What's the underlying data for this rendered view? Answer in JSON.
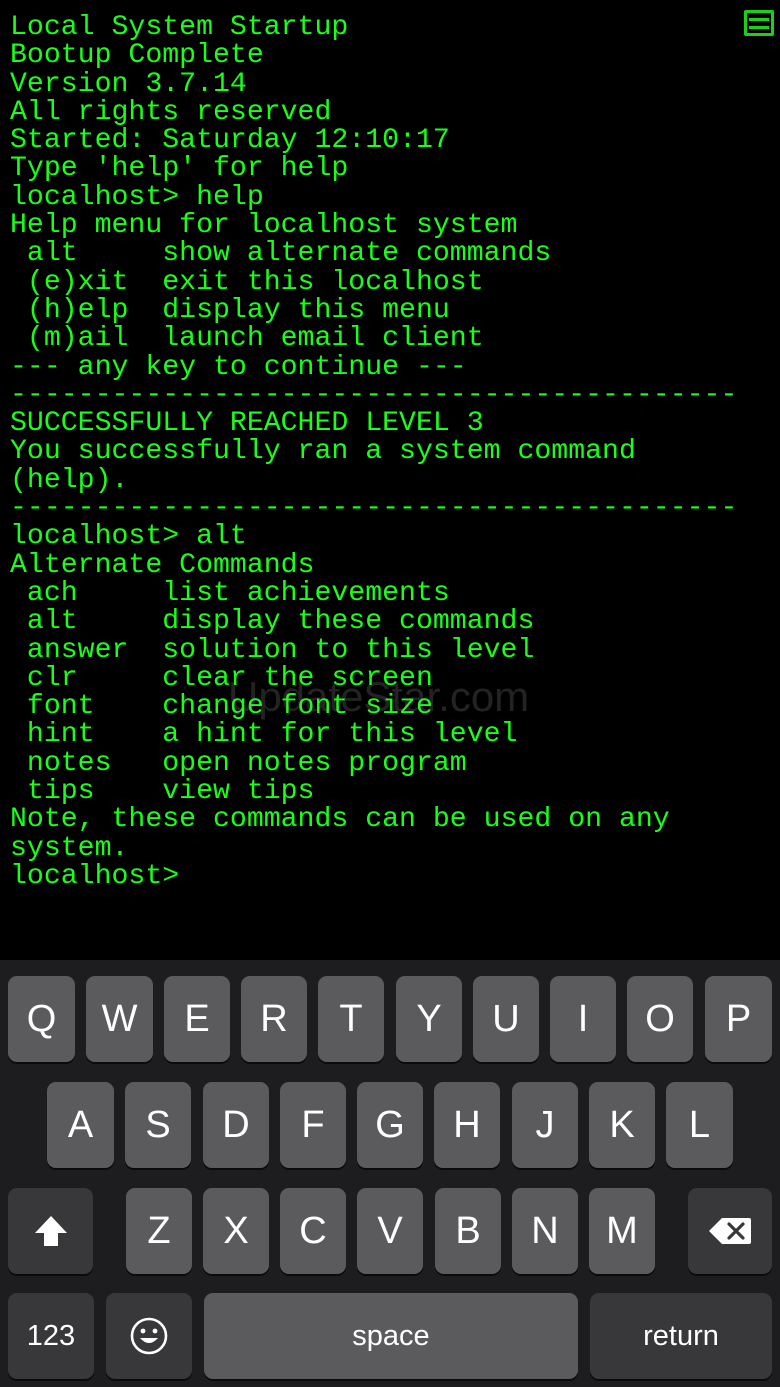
{
  "terminal": {
    "lines": [
      "Local System Startup",
      "Bootup Complete",
      "Version 3.7.14",
      "All rights reserved",
      "Started: Saturday 12:10:17",
      "Type 'help' for help",
      "localhost> help",
      "Help menu for localhost system",
      " alt     show alternate commands",
      " (e)xit  exit this localhost",
      " (h)elp  display this menu",
      " (m)ail  launch email client",
      "--- any key to continue ---",
      "-------------------------------------------",
      "SUCCESSFULLY REACHED LEVEL 3",
      "You successfully ran a system command",
      "(help).",
      "-------------------------------------------",
      "localhost> alt",
      "Alternate Commands",
      " ach     list achievements",
      " alt     display these commands",
      " answer  solution to this level",
      " clr     clear the screen",
      " font    change font size",
      " hint    a hint for this level",
      " notes   open notes program",
      " tips    view tips",
      "Note, these commands can be used on any",
      "system.",
      "localhost>"
    ],
    "text_color": "#19ff19",
    "background": "#000000"
  },
  "watermark": "UpdateStar.com",
  "menu_icon": "hamburger-menu-icon",
  "keyboard": {
    "row1": [
      "Q",
      "W",
      "E",
      "R",
      "T",
      "Y",
      "U",
      "I",
      "O",
      "P"
    ],
    "row2": [
      "A",
      "S",
      "D",
      "F",
      "G",
      "H",
      "J",
      "K",
      "L"
    ],
    "row3": [
      "Z",
      "X",
      "C",
      "V",
      "B",
      "N",
      "M"
    ],
    "shift_icon": "shift-arrow-icon",
    "backspace_icon": "backspace-icon",
    "numbers_label": "123",
    "emoji_icon": "emoji-smiley-icon",
    "space_label": "space",
    "return_label": "return",
    "key_color": "#5b5b5e",
    "dark_key_color": "#38383a",
    "background": "#1d1d1f"
  }
}
